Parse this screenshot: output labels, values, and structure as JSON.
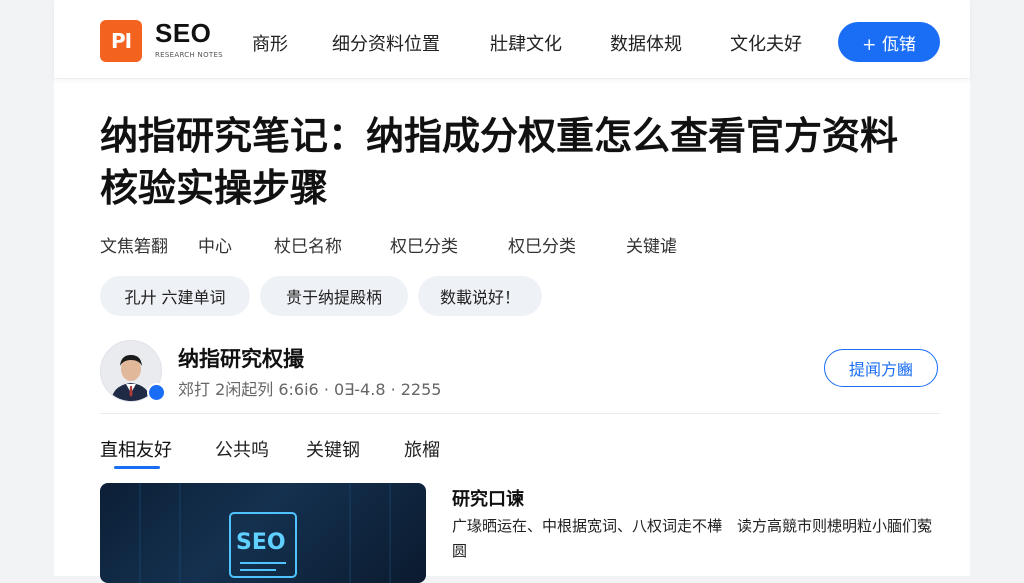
{
  "header": {
    "logo_badge": "PI",
    "logo_text": "SEO",
    "logo_sub": "RESEARCH NOTES",
    "nav": [
      "商形",
      "细分资料位置",
      "壯肆文化",
      "数据体规",
      "文化夫好"
    ],
    "cta_label": "+ 佤锗",
    "accent_color": "#1a6ef5",
    "logo_color": "#f4621f"
  },
  "article": {
    "title": "纳指研究笔记：纳指成分权重怎么查看官方资料核验实操步骤",
    "meta": [
      "文焦箬翻",
      "中心",
      "杖巳名称",
      "权巳分类",
      "权巳分类",
      "关键谑"
    ],
    "tags": [
      "孔廾 六建单词",
      "贵于纳提殿柄",
      "数載说好！"
    ]
  },
  "author": {
    "name": "纳指研究权撮",
    "meta": "郊打 2闲起列 6:6i6 · 0∃-4.8 · 2255",
    "follow_label": "提闻方豳"
  },
  "tabs": [
    "直相友好",
    "公共呜",
    "关键钢",
    "旅榴"
  ],
  "card": {
    "image_text": "SEO",
    "title": "研究口谏",
    "desc": "广瑑晒运在、中根据宽词、八权词走不樺　读方高競市则槵明粒小腼们蒬圆"
  }
}
